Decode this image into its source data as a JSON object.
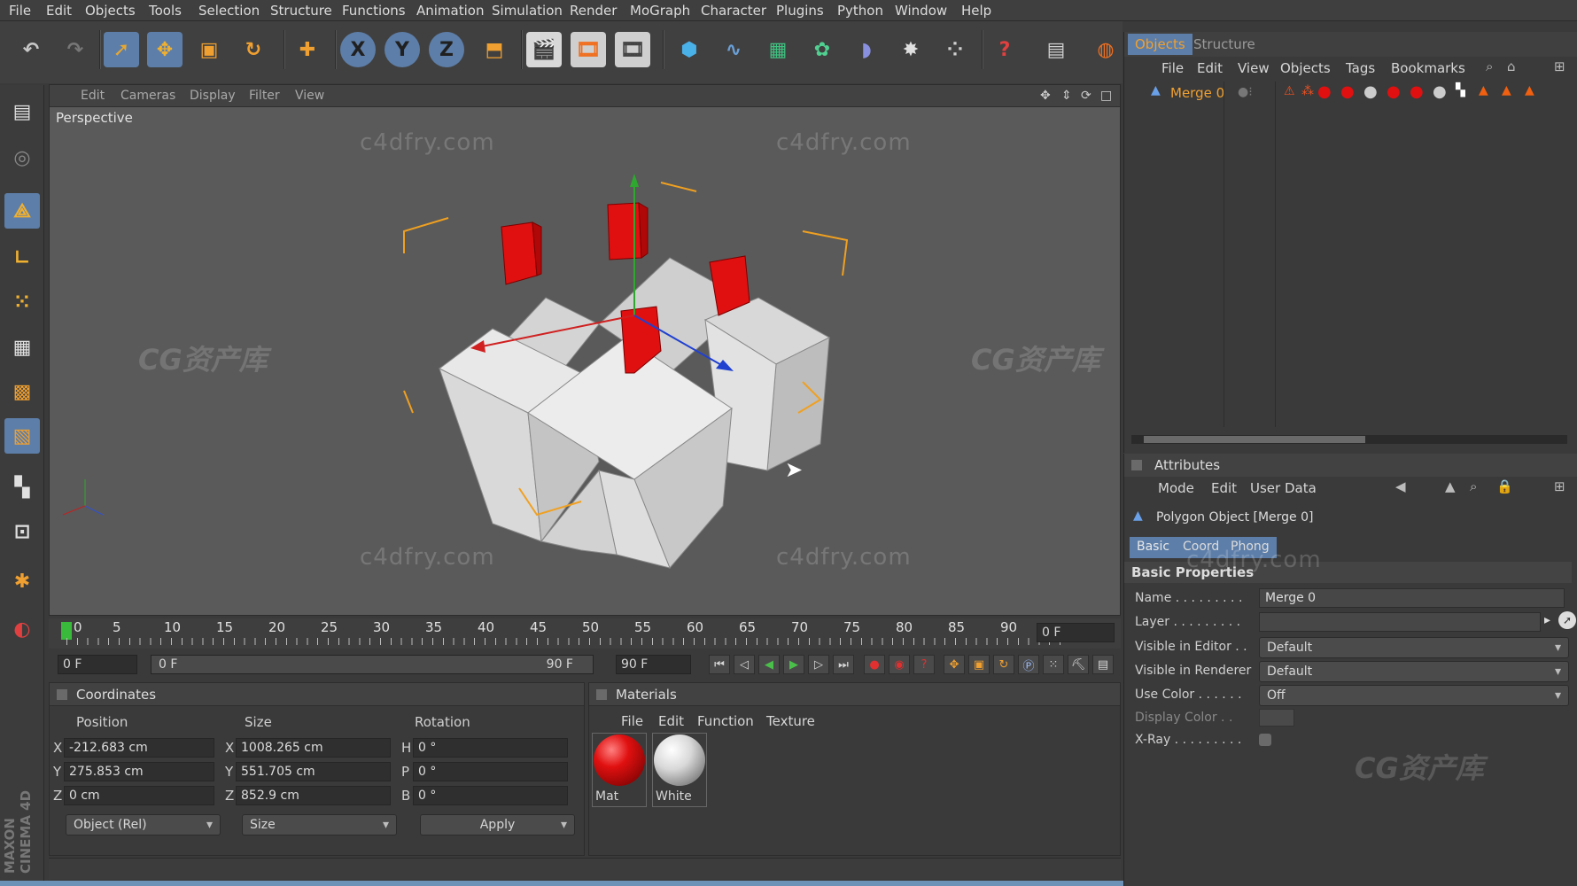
{
  "menubar": [
    "File",
    "Edit",
    "Objects",
    "Tools",
    "Selection",
    "Structure",
    "Functions",
    "Animation",
    "Simulation",
    "Render",
    "MoGraph",
    "Character",
    "Plugins",
    "Python",
    "Window",
    "Help"
  ],
  "toolbar": {
    "icons": [
      "undo-icon",
      "redo-icon",
      "live-selection-icon",
      "move-icon",
      "scale-icon",
      "rotate-icon",
      "add-icon",
      "x-axis-icon",
      "y-axis-icon",
      "z-axis-icon",
      "coordinate-system-icon",
      "render-view-icon",
      "render-picture-viewer-icon",
      "render-settings-icon",
      "cube-icon",
      "spline-icon",
      "nurbs-icon",
      "array-icon",
      "deformer-icon",
      "scene-icon",
      "particles-icon",
      "help-icon",
      "layout-icon",
      "renderer-icon"
    ],
    "axis_labels": [
      "X",
      "Y",
      "Z"
    ]
  },
  "viewport": {
    "menu": [
      "Edit",
      "Cameras",
      "Display",
      "Filter",
      "View"
    ],
    "camera_label": "Perspective",
    "watermarks": [
      "c4dfry.com",
      "CG资产库"
    ]
  },
  "timeline": {
    "ticks": [
      "0",
      "5",
      "10",
      "15",
      "20",
      "25",
      "30",
      "35",
      "40",
      "45",
      "50",
      "55",
      "60",
      "65",
      "70",
      "75",
      "80",
      "85",
      "90"
    ],
    "current_frame": "0 F"
  },
  "transport": {
    "start_field": "0 F",
    "range_start": "0 F",
    "range_end": "90 F",
    "end_field": "90 F"
  },
  "coordinates": {
    "title": "Coordinates",
    "col_position": "Position",
    "col_size": "Size",
    "col_rotation": "Rotation",
    "rows": [
      {
        "axis": "X",
        "pos": "-212.683 cm",
        "size_axis": "X",
        "size": "1008.265 cm",
        "rot_axis": "H",
        "rot": "0 °"
      },
      {
        "axis": "Y",
        "pos": "275.853 cm",
        "size_axis": "Y",
        "size": "551.705 cm",
        "rot_axis": "P",
        "rot": "0 °"
      },
      {
        "axis": "Z",
        "pos": "0 cm",
        "size_axis": "Z",
        "size": "852.9 cm",
        "rot_axis": "B",
        "rot": "0 °"
      }
    ],
    "mode": "Object (Rel)",
    "size_mode": "Size",
    "apply": "Apply"
  },
  "materials": {
    "title": "Materials",
    "menu": [
      "File",
      "Edit",
      "Function",
      "Texture"
    ],
    "items": [
      {
        "name": "Mat",
        "color": "#e01010"
      },
      {
        "name": "White",
        "color": "#d8d8d8"
      }
    ]
  },
  "objects_panel": {
    "tabs": [
      "Objects",
      "Structure"
    ],
    "menu": [
      "File",
      "Edit",
      "View",
      "Objects",
      "Tags",
      "Bookmarks"
    ],
    "object_name": "Merge 0"
  },
  "attributes": {
    "title": "Attributes",
    "menu": [
      "Mode",
      "Edit",
      "User Data"
    ],
    "object_title": "Polygon Object [Merge 0]",
    "tabs": [
      "Basic",
      "Coord",
      "Phong"
    ],
    "section": "Basic Properties",
    "rows": [
      {
        "label": "Name . . . . . . . . .",
        "value": "Merge 0"
      },
      {
        "label": "Layer . . . . . . . . .",
        "value": ""
      },
      {
        "label": "Visible in Editor . .",
        "value": "Default"
      },
      {
        "label": "Visible in Renderer",
        "value": "Default"
      },
      {
        "label": "Use Color . . . . . .",
        "value": "Off"
      },
      {
        "label": "Display Color . .",
        "value": ""
      },
      {
        "label": "X-Ray . . . . . . . . .",
        "value": ""
      }
    ]
  },
  "branding": "MAXON CINEMA 4D",
  "colors": {
    "accent": "#5d7ea8",
    "active_orange": "#f0a030",
    "material_red": "#e01010"
  }
}
